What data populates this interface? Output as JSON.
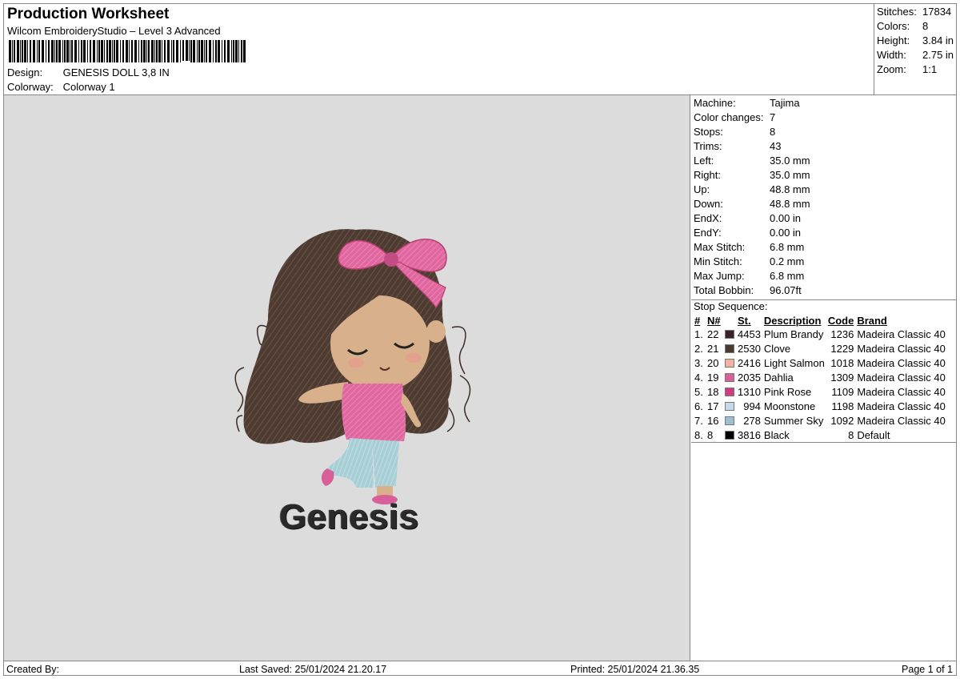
{
  "header": {
    "title": "Production Worksheet",
    "subtitle": "Wilcom EmbroideryStudio – Level 3 Advanced",
    "design_label": "Design:",
    "design_value": "GENESIS DOLL 3,8 IN",
    "colorway_label": "Colorway:",
    "colorway_value": "Colorway 1"
  },
  "summary": [
    {
      "label": "Stitches:",
      "value": "17834"
    },
    {
      "label": "Colors:",
      "value": "8"
    },
    {
      "label": "Height:",
      "value": "3.84 in"
    },
    {
      "label": "Width:",
      "value": "2.75 in"
    },
    {
      "label": "Zoom:",
      "value": "1:1"
    }
  ],
  "machine_stats": [
    {
      "label": "Machine:",
      "value": "Tajima"
    },
    {
      "label": "Color changes:",
      "value": "7"
    },
    {
      "label": "Stops:",
      "value": "8"
    },
    {
      "label": "Trims:",
      "value": "43"
    },
    {
      "label": "Left:",
      "value": "35.0 mm"
    },
    {
      "label": "Right:",
      "value": "35.0 mm"
    },
    {
      "label": "Up:",
      "value": "48.8 mm"
    },
    {
      "label": "Down:",
      "value": "48.8 mm"
    },
    {
      "label": "EndX:",
      "value": "0.00 in"
    },
    {
      "label": "EndY:",
      "value": "0.00 in"
    },
    {
      "label": "Max Stitch:",
      "value": "6.8 mm"
    },
    {
      "label": "Min Stitch:",
      "value": "0.2 mm"
    },
    {
      "label": "Max Jump:",
      "value": "6.8 mm"
    },
    {
      "label": "Total Bobbin:",
      "value": "96.07ft"
    }
  ],
  "stop_sequence": {
    "title": "Stop Sequence:",
    "columns": [
      "#",
      "N#",
      "St.",
      "Description",
      "Code",
      "Brand"
    ],
    "rows": [
      {
        "num": "1.",
        "n": "22",
        "color": "#3a2228",
        "st": "4453",
        "desc": "Plum Brandy",
        "code": "1236",
        "brand": "Madeira Classic 40"
      },
      {
        "num": "2.",
        "n": "21",
        "color": "#4a3a2e",
        "st": "2530",
        "desc": "Clove",
        "code": "1229",
        "brand": "Madeira Classic 40"
      },
      {
        "num": "3.",
        "n": "20",
        "color": "#f2b4a0",
        "st": "2416",
        "desc": "Light Salmon",
        "code": "1018",
        "brand": "Madeira Classic 40"
      },
      {
        "num": "4.",
        "n": "19",
        "color": "#d8609a",
        "st": "2035",
        "desc": "Dahlia",
        "code": "1309",
        "brand": "Madeira Classic 40"
      },
      {
        "num": "5.",
        "n": "18",
        "color": "#cc3f7c",
        "st": "1310",
        "desc": "Pink Rose",
        "code": "1109",
        "brand": "Madeira Classic 40"
      },
      {
        "num": "6.",
        "n": "17",
        "color": "#c6d8ec",
        "st": "994",
        "desc": "Moonstone",
        "code": "1198",
        "brand": "Madeira Classic 40"
      },
      {
        "num": "7.",
        "n": "16",
        "color": "#9cbfd2",
        "st": "278",
        "desc": "Summer Sky",
        "code": "1092",
        "brand": "Madeira Classic 40"
      },
      {
        "num": "8.",
        "n": "8",
        "color": "#000000",
        "st": "3816",
        "desc": "Black",
        "code": "8",
        "brand": "Default"
      }
    ]
  },
  "preview": {
    "embroidery_text": "Genesis"
  },
  "footer": {
    "created_by": "Created By:",
    "last_saved": "Last Saved: 25/01/2024 21.20.17",
    "printed": "Printed: 25/01/2024 21.36.35",
    "page": "Page 1 of 1"
  }
}
